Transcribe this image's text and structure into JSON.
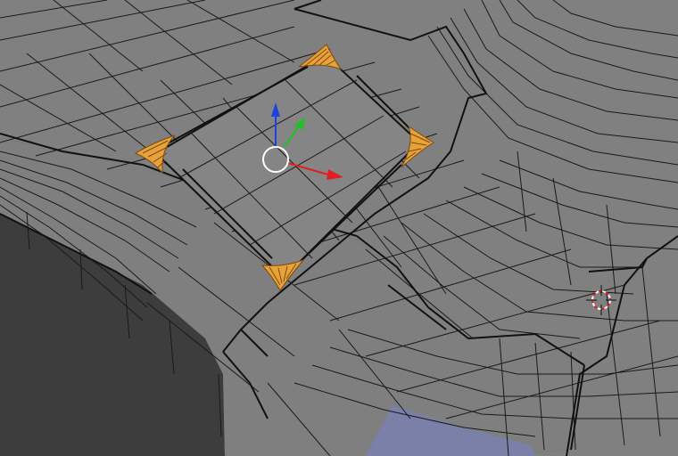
{
  "viewport": {
    "mode": "edit-mode-wireframe",
    "colors": {
      "background": "#3d3d3d",
      "mesh_face": "#808081",
      "mesh_face_shade": "#747476",
      "wire": "#1a1a1a",
      "selected_face": "#e8a23a",
      "selected_wire": "#7a4a10",
      "blue_face": "#7a80a8"
    }
  },
  "manipulator": {
    "icons": [
      "translate-center-circle-icon",
      "x-axis-arrow-icon",
      "y-axis-arrow-icon",
      "z-axis-arrow-icon"
    ],
    "colors": {
      "x": "#e02020",
      "y": "#20c020",
      "z": "#2040e0",
      "center": "#ffffff"
    }
  },
  "cursor_3d": {
    "icon": "3d-cursor-icon",
    "colors": {
      "ring_a": "#e02020",
      "ring_b": "#ffffff",
      "cross": "#111111"
    }
  },
  "selected_corners": {
    "count": 4,
    "color": "#e8a23a"
  }
}
